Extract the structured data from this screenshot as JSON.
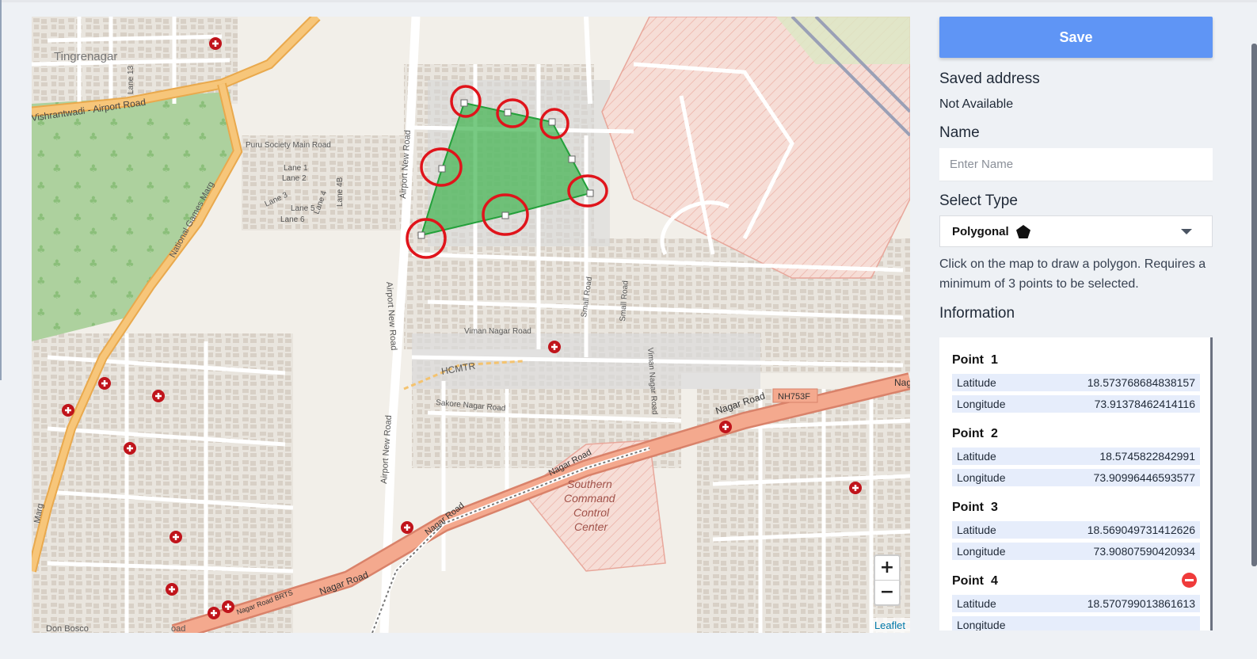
{
  "map": {
    "labels": {
      "tingrenagar": "Tingrenagar",
      "lane13": "Lane 13",
      "vishrantwadi": "Vishrantwadi - Airport Road",
      "puru": "Puru Society Main Road",
      "lane1": "Lane 1",
      "lane2": "Lane 2",
      "lane3": "Lane 3",
      "lane4": "Lane 4",
      "lane4b": "Lane 4B",
      "lane5": "Lane 5",
      "lane6": "Lane 6",
      "national_games": "National Games Marg",
      "airport_new_road_1": "Airport New Road",
      "airport_new_road_2": "Airport New Road",
      "airport_new_road_3": "Airport New Road",
      "viman_nagar_road_1": "Viman Nagar Road",
      "viman_nagar_road_2": "Viman Nagar Road",
      "small_road_1": "Small Road",
      "small_road_2": "Small Road",
      "hcmtr": "HCMTR",
      "sakore": "Sakore Nagar Road",
      "nagar_road_1": "Nagar Road",
      "nagar_road_2": "Nagar Road",
      "nagar_road_3": "Nagar Road",
      "nagar_road_4": "Nagar Road",
      "nagar_road_5": "Nagar Road",
      "nh": "NH753F",
      "nagar_brts": "Nagar Road BRTS",
      "marg": "Marg",
      "don_bosco": "Don Bosco",
      "oad": "oad",
      "nag": "Nag",
      "southern_1": "Southern",
      "southern_2": "Command",
      "southern_3": "Control",
      "southern_4": "Center"
    },
    "zoom_in": "+",
    "zoom_out": "−",
    "attribution": "Leaflet"
  },
  "panel": {
    "save_label": "Save",
    "saved_address_heading": "Saved address",
    "saved_address_value": "Not Available",
    "name_heading": "Name",
    "name_placeholder": "Enter Name",
    "type_heading": "Select Type",
    "type_value": "Polygonal",
    "help_text": "Click on the map to draw a polygon. Requires a minimum of 3 points to be selected.",
    "information_heading": "Information"
  },
  "points": [
    {
      "title": "Point",
      "num": "1",
      "lat_label": "Latitude",
      "lat": "18.573768684838157",
      "lng_label": "Longitude",
      "lng": "73.91378462414116"
    },
    {
      "title": "Point",
      "num": "2",
      "lat_label": "Latitude",
      "lat": "18.5745822842991",
      "lng_label": "Longitude",
      "lng": "73.90996446593577"
    },
    {
      "title": "Point",
      "num": "3",
      "lat_label": "Latitude",
      "lat": "18.569049731412626",
      "lng_label": "Longitude",
      "lng": "73.90807590420934"
    },
    {
      "title": "Point",
      "num": "4",
      "lat_label": "Latitude",
      "lat": "18.570799013861613",
      "lng_label": "Longitude",
      "lng": ""
    }
  ],
  "colors": {
    "save": "#5f95f5",
    "polygon": "#3fb34f",
    "highlight_ring": "#e0141b",
    "road_major": "#f0a07e",
    "road_secondary": "#f5b15a",
    "park": "#b7dca8",
    "military": "#f3c7c0"
  },
  "icons": {
    "polygon_type": "pentagon-icon",
    "caret": "caret-down-icon",
    "remove": "remove-point-icon",
    "hospital": "hospital-icon"
  }
}
